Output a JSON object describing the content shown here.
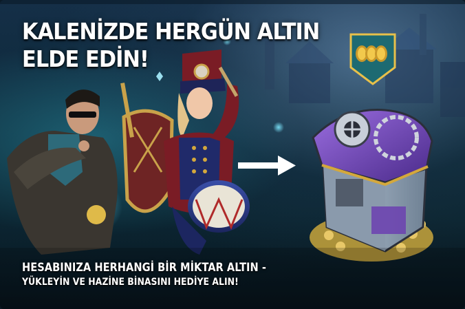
{
  "banner": {
    "headline_line1": "KALENİZDE HERGÜN ALTIN",
    "headline_line2": "ELDE EDİN!",
    "subline_line1": "HESABINIZA HERHANGİ BİR MİKTAR ALTIN -",
    "subline_line2": "YÜKLEYİN VE HAZİNE BİNASINI HEDİYE ALIN!"
  },
  "colors": {
    "text": "#ffffff",
    "badge_fill": "#1d6a72",
    "badge_border": "#e8c04a",
    "coin": "#f2c94c",
    "building_roof": "#6a3fb5",
    "arrow": "#ffffff"
  },
  "icons": [
    "gold-coins-icon",
    "right-arrow-icon"
  ]
}
